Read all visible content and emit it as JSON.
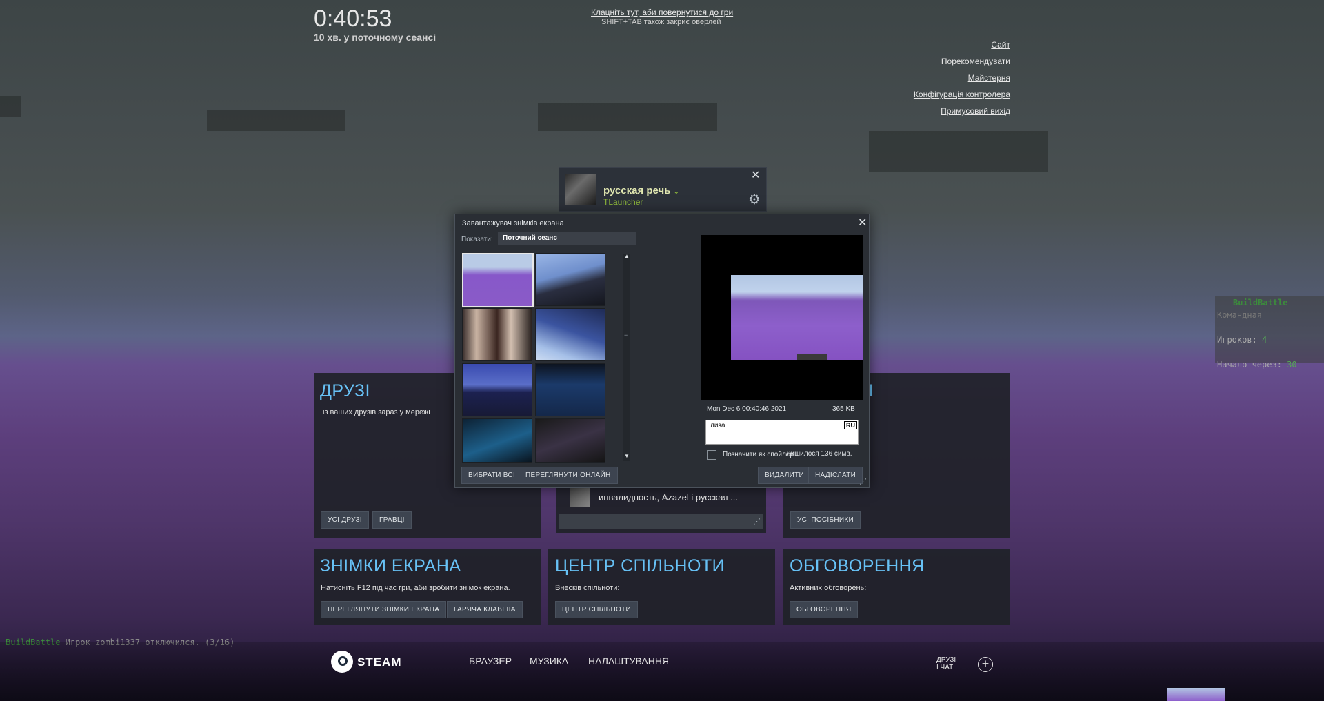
{
  "session": {
    "time": "0:40:53",
    "subtitle": "10 хв. у поточному сеансі"
  },
  "overlay_hint": {
    "link": "Клацніть тут, аби повернутися до гри",
    "sub": "SHIFT+TAB  також закриє оверлей"
  },
  "right_links": [
    "Сайт",
    "Порекомендувати",
    "Майстерня",
    "Конфігурація контролера",
    "Примусовий вихід"
  ],
  "friend_card": {
    "name": "русская речь",
    "game": "TLauncher"
  },
  "modal": {
    "title": "Завантажувач знімків екрана",
    "show_label": "Показати:",
    "show_value": "Поточний сеанс",
    "date": "Mon Dec  6 00:40:46 2021",
    "size": "365 KB",
    "caption": "лиза",
    "lang": "RU",
    "spoiler_label": "Позначити як спойлер",
    "chars_left": "Лишилося 136 симв.",
    "select_all": "ВИБРАТИ ВСІ",
    "view_online": "ПЕРЕГЛЯНУТИ ОНЛАЙН",
    "delete": "ВИДАЛИТИ",
    "send": "НАДІСЛАТИ"
  },
  "panels": {
    "friends": {
      "title": "ДРУЗІ",
      "text": "із ваших друзів зараз у мережі",
      "btn_all": "УСІ ДРУЗІ",
      "btn_players": "ГРАВЦІ"
    },
    "chat_group": {
      "text": "инвалидность, Azazel і русская ..."
    },
    "guides": {
      "title_partial": "КИ",
      "btn": "УСІ ПОСІБНИКИ"
    },
    "screenshots": {
      "title": "ЗНІМКИ ЕКРАНА",
      "text": "Натисніть F12 під час гри, аби зробити знімок екрана.",
      "btn_view": "ПЕРЕГЛЯНУТИ ЗНІМКИ ЕКРАНА",
      "btn_hotkey": "ГАРЯЧА КЛАВІША"
    },
    "community": {
      "title": "ЦЕНТР СПІЛЬНОТИ",
      "text": "Внесків спільноти:",
      "btn": "ЦЕНТР СПІЛЬНОТИ"
    },
    "discussions": {
      "title": "ОБГОВОРЕННЯ",
      "text": "Активних обговорень:",
      "btn": "ОБГОВОРЕННЯ"
    }
  },
  "bottom_nav": {
    "steam": "STEAM",
    "browser": "БРАУЗЕР",
    "music": "МУЗИКА",
    "settings": "НАЛАШТУВАННЯ",
    "friends_chat_1": "ДРУЗІ",
    "friends_chat_2": "І ЧАТ"
  },
  "game_chat": {
    "tag": "BuildBattle",
    "message": "Игрок zombi1337 отключился. (3/16)"
  },
  "scoreboard": {
    "title": "BuildBattle",
    "mode": "Командная",
    "players_label": "Игроков:",
    "players_value": "4",
    "start_label": "Начало через:",
    "start_value": "30"
  },
  "colors": {
    "accent_blue": "#67c1f5",
    "game_green": "#8fb93b"
  }
}
